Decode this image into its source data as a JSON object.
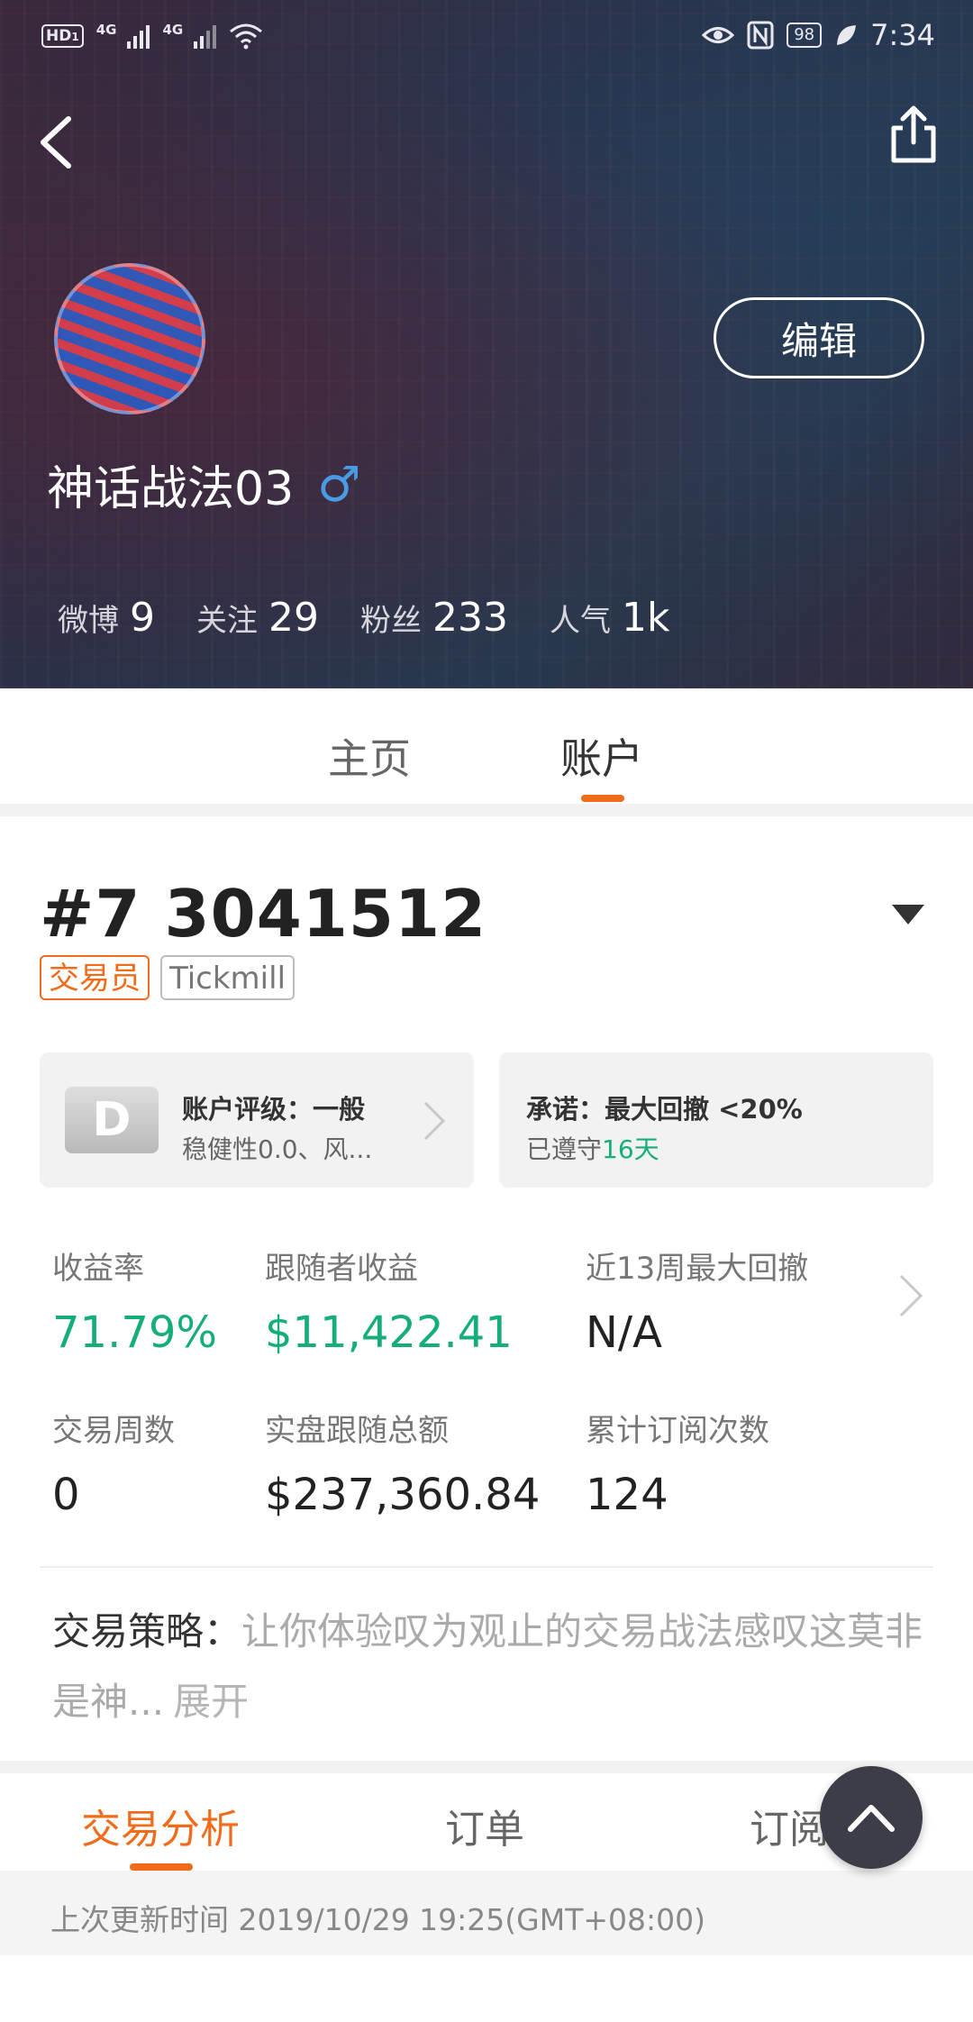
{
  "status_bar": {
    "left_badge": "HD",
    "left_badge_sub": "1",
    "network_1": "4G",
    "network_2": "4G",
    "battery": "98",
    "time": "7:34"
  },
  "profile": {
    "username": "神话战法03",
    "gender_symbol": "♂",
    "edit_label": "编辑",
    "stats": [
      {
        "label": "微博",
        "value": "9"
      },
      {
        "label": "关注",
        "value": "29"
      },
      {
        "label": "粉丝",
        "value": "233"
      },
      {
        "label": "人气",
        "value": "1k"
      }
    ]
  },
  "main_tabs": [
    {
      "label": "主页",
      "active": false
    },
    {
      "label": "账户",
      "active": true
    }
  ],
  "account": {
    "number": "#7 3041512",
    "tags": [
      "交易员",
      "Tickmill"
    ],
    "rating_card": {
      "grade": "D",
      "title": "账户评级：一般",
      "subtitle": "稳健性0.0、风..."
    },
    "promise_card": {
      "title": "承诺：最大回撤 <20%",
      "subtitle_prefix": "已遵守",
      "subtitle_days": "16天"
    },
    "metrics": [
      {
        "label": "收益率",
        "value": "71.79%",
        "highlight": true
      },
      {
        "label": "跟随者收益",
        "value": "$11,422.41",
        "highlight": true
      },
      {
        "label": "近13周最大回撤",
        "value": "N/A",
        "highlight": false
      },
      {
        "label": "交易周数",
        "value": "0",
        "highlight": false
      },
      {
        "label": "实盘跟随总额",
        "value": "$237,360.84",
        "highlight": false
      },
      {
        "label": "累计订阅次数",
        "value": "124",
        "highlight": false
      }
    ],
    "strategy": {
      "label": "交易策略：",
      "text": "让你体验叹为观止的交易战法感叹这莫非是神...",
      "more": "展开"
    }
  },
  "sub_tabs": [
    {
      "label": "交易分析",
      "active": true
    },
    {
      "label": "订单",
      "active": false
    },
    {
      "label": "订阅者",
      "active": false
    }
  ],
  "update": {
    "text": "上次更新时间 2019/10/29 19:25(GMT+08:00)"
  },
  "colors": {
    "accent_orange": "#f06b1a",
    "positive_green": "#15ae7a",
    "gender_blue": "#4a9be6"
  },
  "icons": {
    "back": "chevron-left-icon",
    "share": "share-icon",
    "dropdown": "triangle-down-icon",
    "fab": "chevron-up-icon"
  }
}
